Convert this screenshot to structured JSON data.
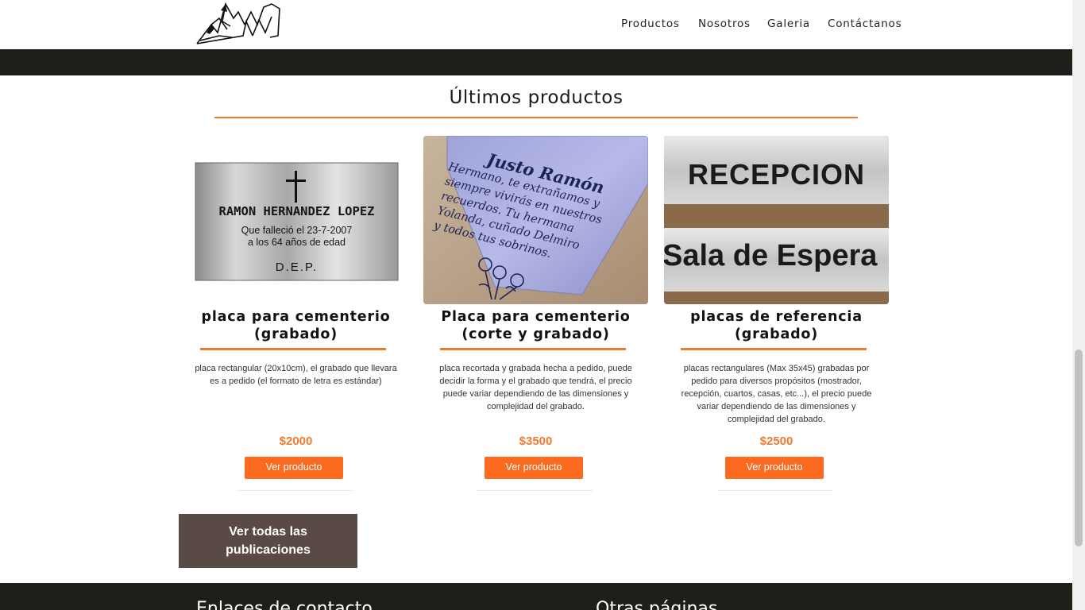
{
  "nav": {
    "items": [
      "Productos",
      "Nosotros",
      "Galeria",
      "Contáctanos"
    ]
  },
  "section": {
    "title": "Últimos productos"
  },
  "products": [
    {
      "name_line1": "placa para cementerio",
      "name_line2": "(grabado)",
      "description": "placa rectangular (20x10cm), el grabado que llevara es a pedido (el formato de letra es estándar)",
      "price": "$2000",
      "button": "Ver producto",
      "image": {
        "line1": "RAMON HERNANDEZ LOPEZ",
        "line2": "Que falleció el 23-7-2007",
        "line3": "a los 64 años de edad",
        "line4": "D.E.P."
      }
    },
    {
      "name_line1": "Placa para cementerio",
      "name_line2": "(corte y grabado)",
      "description": "placa recortada y grabada hecha a pedido, puede decidir la forma y el grabado que tendrá, el precio puede variar dependiendo de las dimensiones y complejidad del grabado.",
      "price": "$3500",
      "button": "Ver producto",
      "image": {
        "title": "Justo Ramón",
        "l1": "Hermano, te extrañamos y",
        "l2": "siempre vivirás en nuestros",
        "l3": "recuerdos. Tu hermana",
        "l4": "Yolanda, cuñado Delmiro",
        "l5": "y todos tus sobrinos."
      }
    },
    {
      "name_line1": "placas de referencia",
      "name_line2": "(grabado)",
      "description": "placas rectangulares (Max 35x45) grabadas por pedido para diversos propósitos (mostrador, recepción, cuartos, casas, etc...), el precio puede variar dependiendo de las dimensiones y complejidad del grabado.",
      "price": "$2500",
      "button": "Ver producto",
      "image": {
        "line1": "RECEPCION",
        "line2": "Sala de Espera"
      }
    }
  ],
  "all_button": {
    "line1": "Ver todas las",
    "line2": "publicaciones"
  },
  "footer": {
    "left_heading": "Enlaces de contacto",
    "right_heading": "Otras páginas"
  },
  "colors": {
    "accent": "#f07a2c",
    "button": "#fb6a1f",
    "dark": "#1f1f1a",
    "all_button": "#594a45"
  },
  "icons": {
    "logo": "mountain-logo-icon"
  }
}
